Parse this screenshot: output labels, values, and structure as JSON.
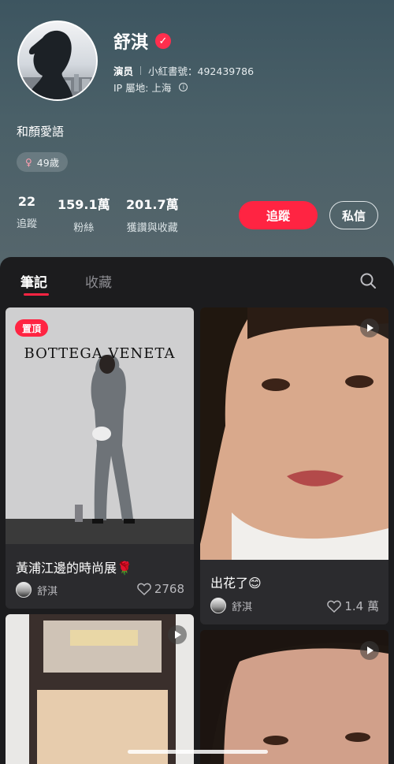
{
  "profile": {
    "name": "舒淇",
    "role": "演员",
    "redbook_id": "小紅書號：492439786",
    "ip_location": "IP 屬地: 上海",
    "bio": "和顏愛語",
    "age_tag": "49歲"
  },
  "stats": [
    {
      "value": "22",
      "label": "追蹤"
    },
    {
      "value": "159.1萬",
      "label": "粉絲"
    },
    {
      "value": "201.7萬",
      "label": "獲讚與收藏"
    }
  ],
  "actions": {
    "follow": "追蹤",
    "message": "私信"
  },
  "tabs": {
    "notes": "筆記",
    "collections": "收藏"
  },
  "notes": [
    {
      "pinned_label": "置頂",
      "brand_text": "BOTTEGA VENETA",
      "title": "黃浦江邊的時尚展🌹",
      "author": "舒淇",
      "likes": "2768"
    },
    {
      "title": "出花了😊",
      "author": "舒淇",
      "likes": "1.4 萬"
    }
  ],
  "colors": {
    "accent": "#ff2442",
    "header_bg": "#4a6068",
    "content_bg": "#1c1c1e"
  }
}
